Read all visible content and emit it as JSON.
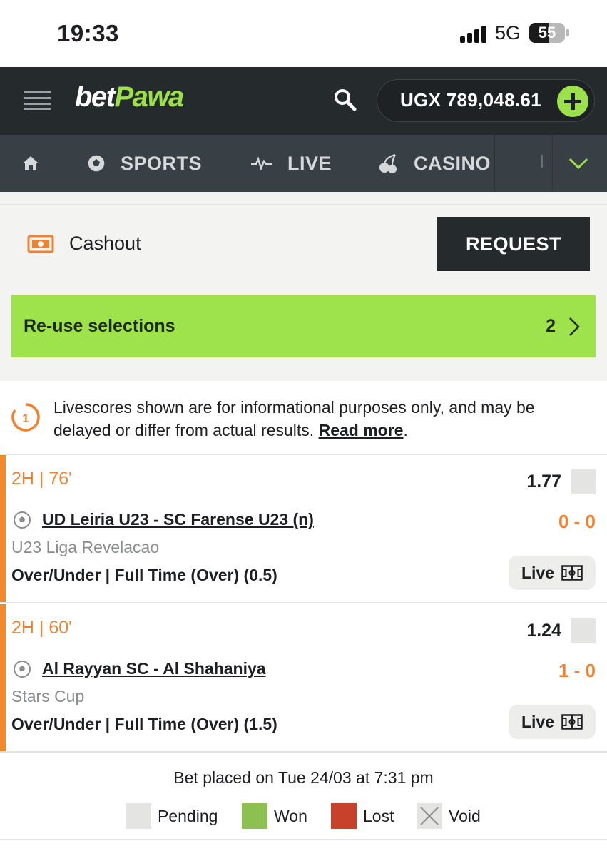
{
  "status_bar": {
    "time": "19:33",
    "network": "5G",
    "battery": "55",
    "battery_level": 0.55
  },
  "header": {
    "logo_part1": "bet",
    "logo_part2": "Pawa",
    "balance": "UGX 789,048.61"
  },
  "nav": {
    "items": [
      "SPORTS",
      "LIVE",
      "CASINO"
    ],
    "more": "I"
  },
  "cashout": {
    "label": "Cashout",
    "button": "REQUEST"
  },
  "reuse": {
    "label": "Re-use selections",
    "count": "2"
  },
  "disclaimer": {
    "badge": "1",
    "text": "Livescores shown are for informational purposes only, and may be delayed or differ from actual results. ",
    "link": "Read more",
    "end": "."
  },
  "bets": [
    {
      "time": "2H | 76'",
      "odds": "1.77",
      "match": "UD Leiria U23 - SC Farense U23 (n)",
      "score": "0 - 0",
      "league": "U23 Liga Revelacao",
      "market": "Over/Under | Full Time (Over) (0.5)",
      "live": "Live"
    },
    {
      "time": "2H | 60'",
      "odds": "1.24",
      "match": "Al Rayyan SC - Al Shahaniya",
      "score": "1 - 0",
      "league": "Stars Cup",
      "market": "Over/Under | Full Time (Over) (1.5)",
      "live": "Live"
    }
  ],
  "footer": {
    "placed": "Bet placed on Tue 24/03 at 7:31 pm",
    "legend": [
      {
        "label": "Pending",
        "color": "#e4e4e2"
      },
      {
        "label": "Won",
        "color": "#8cc152"
      },
      {
        "label": "Lost",
        "color": "#c8412a"
      },
      {
        "label": "Void",
        "color": "#e4e4e2"
      }
    ]
  },
  "colors": {
    "brand_green": "#9ce14b",
    "accent_orange": "#ef8230",
    "header_dark": "#252a2d",
    "nav_grey": "#394045"
  },
  "icons": [
    "hamburger-icon",
    "search-icon",
    "plus-icon",
    "home-icon",
    "soccer-ball-icon",
    "pulse-icon",
    "cherries-icon",
    "chevron-down-icon",
    "cashout-icon",
    "chevron-right-icon",
    "clock-icon",
    "pitch-icon"
  ]
}
